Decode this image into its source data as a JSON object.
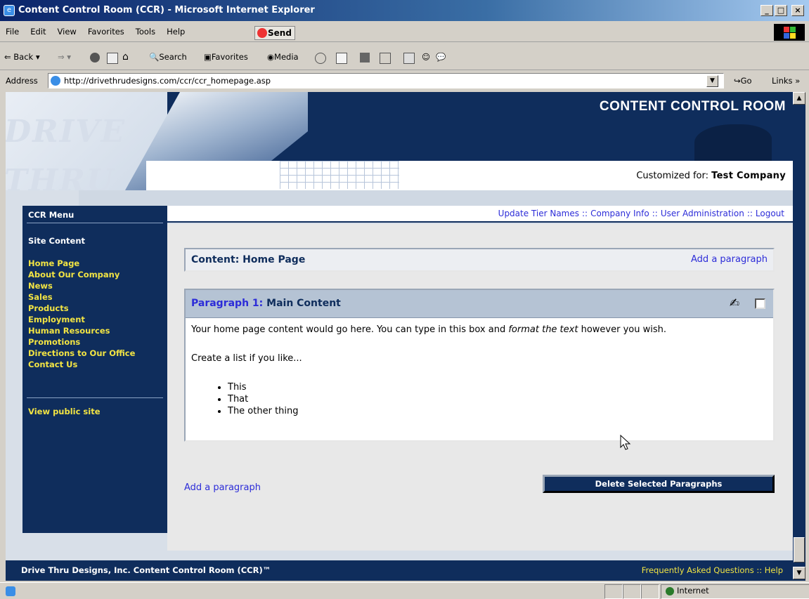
{
  "window": {
    "title": "Content Control Room (CCR) - Microsoft Internet Explorer"
  },
  "menubar": {
    "items": [
      "File",
      "Edit",
      "View",
      "Favorites",
      "Tools",
      "Help"
    ],
    "send": "Send"
  },
  "toolbar": {
    "back": "Back",
    "search": "Search",
    "favorites": "Favorites",
    "media": "Media"
  },
  "address": {
    "label": "Address",
    "url": "http://drivethrudesigns.com/ccr/ccr_homepage.asp",
    "go": "Go",
    "links": "Links »"
  },
  "header": {
    "logo": "DRIVE THRU",
    "title": "CONTENT CONTROL ROOM",
    "customized_label": "Customized for:",
    "company": "Test Company"
  },
  "sidebar": {
    "title": "CCR Menu",
    "section": "Site Content",
    "items": [
      "Home Page",
      "About Our Company",
      "News",
      "Sales",
      "Products",
      "Employment",
      "Human Resources",
      "Promotions",
      "Directions to Our Office",
      "Contact Us"
    ],
    "public_link": "View public site"
  },
  "topnav": {
    "links": [
      "Update Tier Names",
      "Company Info",
      "User Administration",
      "Logout"
    ],
    "separator": "::"
  },
  "content": {
    "title": "Content: Home Page",
    "add_paragraph": "Add a paragraph",
    "paragraph": {
      "number": "Paragraph 1:",
      "name": "Main Content",
      "text_before": "Your home page content would go here.  You can type in this box and ",
      "text_italic": "format the text",
      "text_after": " however you wish.",
      "list_intro": "Create a list if you like...",
      "list": [
        "This",
        "That",
        "The other thing"
      ]
    },
    "delete_button": "Delete Selected Paragraphs"
  },
  "footer": {
    "left": "Drive Thru Designs, Inc.  Content Control Room (CCR)™",
    "faq": "Frequently Asked Questions",
    "separator": "::",
    "help": "Help"
  },
  "status": {
    "zone": "Internet"
  },
  "colors": {
    "navy": "#0f2d5c",
    "link_blue": "#2c2cd8",
    "menu_yellow": "#f2e443"
  }
}
